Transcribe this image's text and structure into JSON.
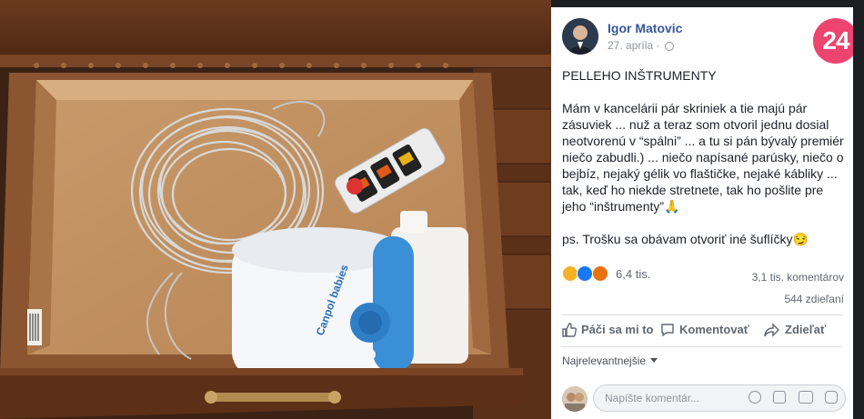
{
  "post": {
    "author": "Igor Matovic",
    "date": "27. apríla",
    "privacy_icon": "globe-icon",
    "title": "PELLEHO INŠTRUMENTY",
    "body": "Mám v kancelárii pár skriniek a tie majú pár zásuviek ... nuž a teraz som otvoril jednu dosial neotvorenú v “spálni” ... a tu si pán bývalý premiér niečo zabudli.) ... niečo napísané parúsky, niečo o bejbíz, nejaký gélik vo flaštičke, nejaké kábliky ... tak, keď ho niekde stretnete, tak ho pošlite pre jeho “inštrumenty”🙏",
    "ps": "ps. Trošku sa obávam otvoriť iné šuflíčky😏"
  },
  "brand": {
    "logo_text": "24",
    "color": "#ee4470"
  },
  "reactions": {
    "icons": [
      "haha-icon",
      "like-icon",
      "angry-icon"
    ],
    "count": "6,4 tis.",
    "comments": "3,1 tis. komentárov",
    "shares": "544 zdieľaní"
  },
  "actions": {
    "like": "Páči sa mi to",
    "comment": "Komentovať",
    "share": "Zdieľať"
  },
  "sort": {
    "label": "Najrelevantnejšie"
  },
  "comment_box": {
    "placeholder": "Napíšte komentár..."
  },
  "photo": {
    "product_brand": "Canpol babies"
  },
  "colors": {
    "link": "#385898",
    "muted": "#606770",
    "panel_bg": "#ffffff",
    "page_bg": "#1c1e21"
  }
}
